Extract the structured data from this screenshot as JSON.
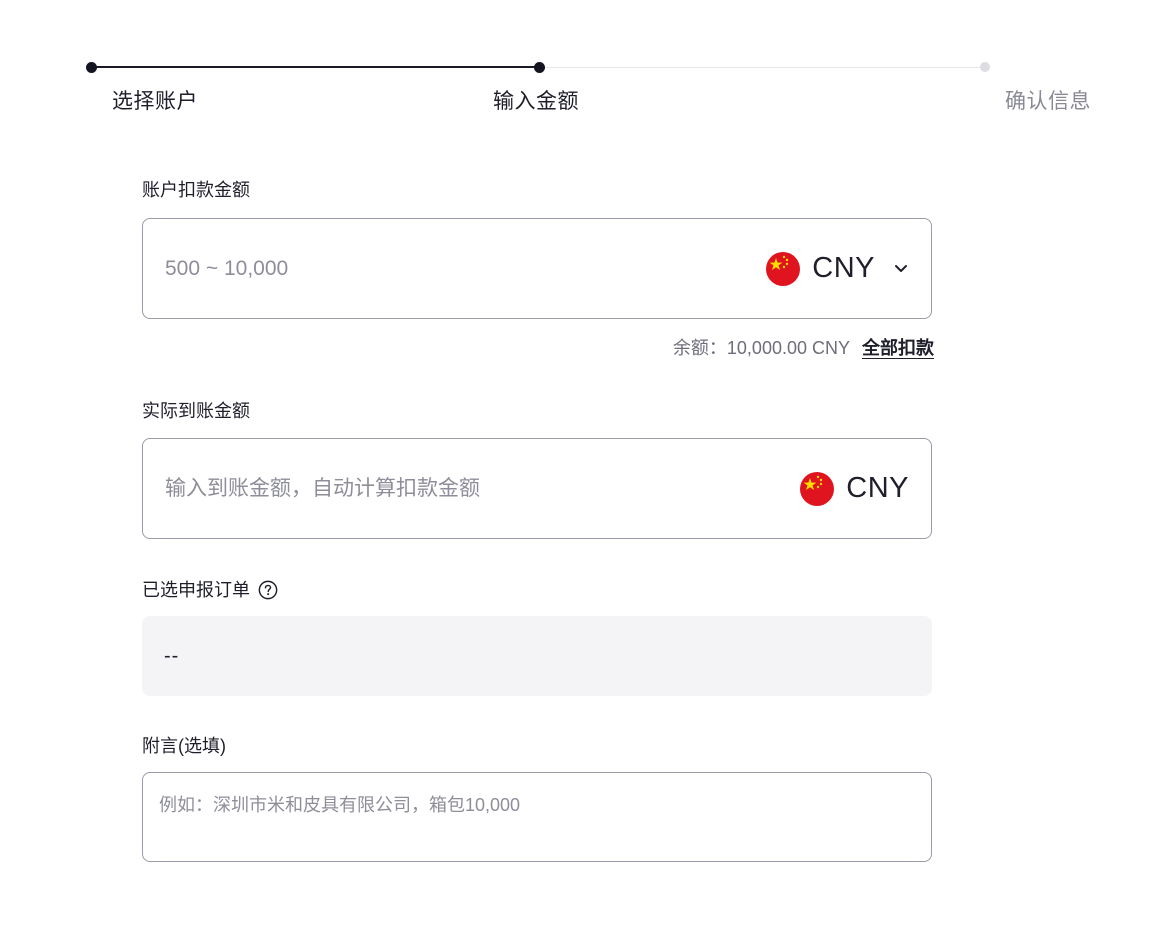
{
  "stepper": {
    "steps": [
      {
        "label": "选择账户",
        "state": "done"
      },
      {
        "label": "输入金额",
        "state": "current"
      },
      {
        "label": "确认信息",
        "state": "upcoming"
      }
    ]
  },
  "debit": {
    "label": "账户扣款金额",
    "placeholder": "500 ~ 10,000",
    "value": "",
    "currency": "CNY",
    "currency_icon": "china-flag-icon",
    "dropdown_icon": "chevron-down-icon"
  },
  "balance": {
    "text": "余额：10,000.00 CNY",
    "all_link": "全部扣款"
  },
  "received": {
    "label": "实际到账金额",
    "placeholder": "输入到账金额，自动计算扣款金额",
    "value": "",
    "currency": "CNY",
    "currency_icon": "china-flag-icon"
  },
  "orders": {
    "label": "已选申报订单",
    "help_icon": "question-circle-icon",
    "value": "--"
  },
  "note": {
    "label": "附言(选填)",
    "placeholder": "例如：深圳市米和皮具有限公司，箱包10,000",
    "value": ""
  },
  "colors": {
    "accent": "#1a1a24",
    "border": "#9a9aa8",
    "muted_text": "#8a8a96",
    "flag_red": "#e0141e",
    "flag_yellow": "#ffde00",
    "readonly_bg": "#f4f4f6"
  }
}
